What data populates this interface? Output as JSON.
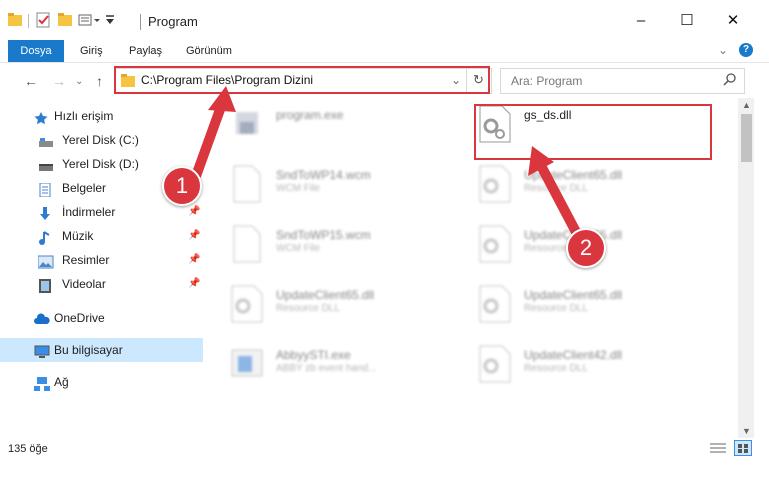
{
  "window": {
    "title": "Program",
    "controls": {
      "minimize": "–",
      "maximize": "☐",
      "close": "✕"
    }
  },
  "ribbon": {
    "tabs": [
      "Dosya",
      "Giriş",
      "Paylaş",
      "Görünüm"
    ],
    "help": "?"
  },
  "address": {
    "path": "C:\\Program Files\\Program Dizini",
    "search_placeholder": "Ara: Program"
  },
  "sidebar": {
    "items": [
      {
        "label": "Hızlı erişim",
        "icon": "star-icon"
      },
      {
        "label": "Yerel Disk (C:)",
        "icon": "drive-icon",
        "pinned": true
      },
      {
        "label": "Yerel Disk (D:)",
        "icon": "drive-icon",
        "pinned": true
      },
      {
        "label": "Belgeler",
        "icon": "documents-icon",
        "pinned": true
      },
      {
        "label": "İndirmeler",
        "icon": "download-icon",
        "pinned": true
      },
      {
        "label": "Müzik",
        "icon": "music-icon",
        "pinned": true
      },
      {
        "label": "Resimler",
        "icon": "pictures-icon",
        "pinned": true
      },
      {
        "label": "Videolar",
        "icon": "video-icon",
        "pinned": true
      },
      {
        "label": "OneDrive",
        "icon": "cloud-icon"
      },
      {
        "label": "Bu bilgisayar",
        "icon": "computer-icon",
        "selected": true
      },
      {
        "label": "Ağ",
        "icon": "network-icon"
      }
    ]
  },
  "files": [
    {
      "name": "program.exe",
      "type": "",
      "icon": "exe-icon",
      "blurred": true
    },
    {
      "name": "gs_ds.dll",
      "type": "",
      "icon": "dll-gear-icon",
      "blurred": false
    },
    {
      "name": "SndToWP14.wcm",
      "type": "WCM File",
      "icon": "blank-file-icon",
      "blurred": true
    },
    {
      "name": "UpdateClient65.dll",
      "type": "Resource DLL",
      "icon": "dll-gear-icon",
      "blurred": true
    },
    {
      "name": "SndToWP15.wcm",
      "type": "WCM File",
      "icon": "blank-file-icon",
      "blurred": true
    },
    {
      "name": "UpdateClient65.dll",
      "type": "Resource DLL",
      "icon": "dll-gear-icon",
      "blurred": true
    },
    {
      "name": "UpdateClient65.dll",
      "type": "Resource DLL",
      "icon": "dll-gear-icon",
      "blurred": true
    },
    {
      "name": "UpdateClient65.dll",
      "type": "Resource DLL",
      "icon": "dll-gear-icon",
      "blurred": true
    },
    {
      "name": "AbbyySTI.exe",
      "type": "ABBY zb event hand...",
      "icon": "app-icon",
      "blurred": true
    },
    {
      "name": "UpdateClient42.dll",
      "type": "Resource DLL",
      "icon": "dll-gear-icon",
      "blurred": true
    }
  ],
  "status": {
    "count": "135 öğe"
  },
  "annotations": {
    "badge1": "1",
    "badge2": "2"
  },
  "colors": {
    "accent": "#1979ca",
    "annotation": "#d9363e",
    "selected": "#cce8ff"
  }
}
